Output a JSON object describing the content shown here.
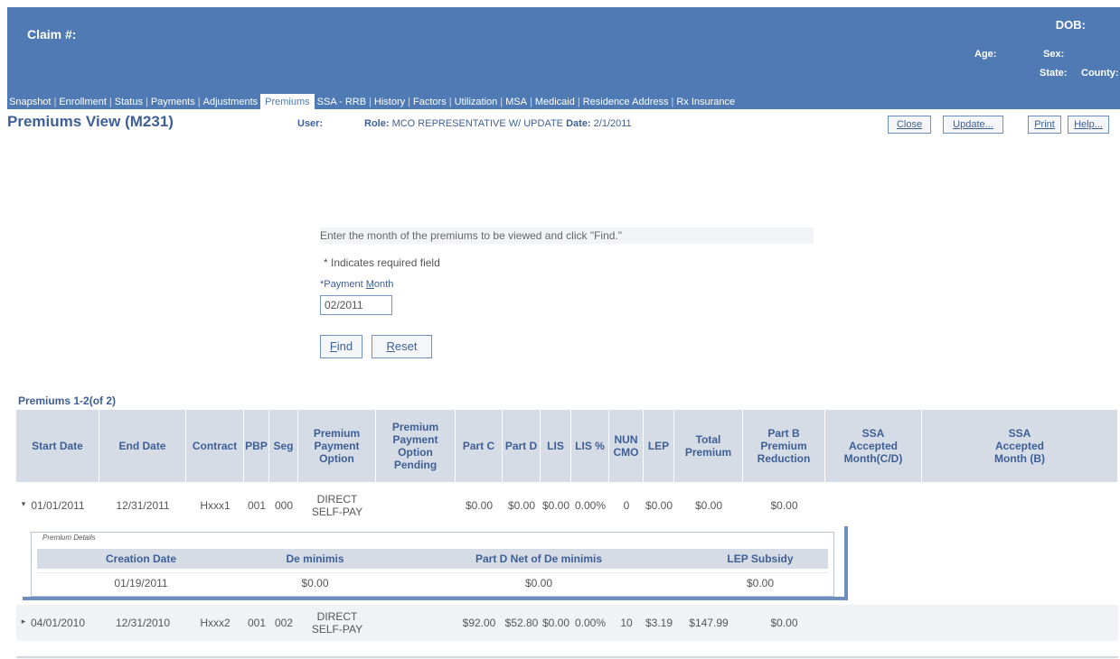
{
  "header": {
    "claim": "Claim #:",
    "dob": "DOB:",
    "age": "Age:",
    "sex": "Sex:",
    "state": "State:",
    "county": "County:"
  },
  "nav": {
    "tabs": [
      "Snapshot",
      "Enrollment",
      "Status",
      "Payments",
      "Adjustments",
      "Premiums",
      "SSA - RRB",
      "History",
      "Factors",
      "Utilization",
      "MSA",
      "Medicaid",
      "Residence Address",
      "Rx Insurance"
    ],
    "active": "Premiums"
  },
  "titlebar": {
    "title": "Premiums View (M231)",
    "user_label": "User:",
    "role_label": "Role:",
    "role_value": "MCO REPRESENTATIVE W/ UPDATE",
    "date_label": "Date:",
    "date_value": "2/1/2011",
    "buttons": {
      "close": "Close",
      "update": "Update...",
      "print": "Print",
      "help": "Help..."
    }
  },
  "form": {
    "instructions": "Enter the month of the premiums to be viewed and click \"Find.\"",
    "required_note": "* Indicates required field",
    "field_label_prefix": "*Payment ",
    "field_label_underlined": "M",
    "field_label_rest": "onth",
    "field_value": "02/2011",
    "find_u": "F",
    "find_rest": "ind",
    "reset_u": "R",
    "reset_rest": "eset"
  },
  "table": {
    "caption": "Premiums 1-2(of 2)",
    "headers": [
      "Start Date",
      "End Date",
      "Contract",
      "PBP",
      "Seg",
      "Premium\nPayment\nOption",
      "Premium\nPayment\nOption\nPending",
      "Part C",
      "Part D",
      "LIS",
      "LIS %",
      "NUN\nCMO",
      "LEP",
      "Total\nPremium",
      "Part B\nPremium\nReduction",
      "SSA\nAccepted\nMonth(C/D)",
      "SSA\nAccepted\nMonth (B)"
    ],
    "rows": [
      {
        "icon": "▾",
        "start": "01/01/2011",
        "end": "12/31/2011",
        "contract": "Hxxx1",
        "pbp": "001",
        "seg": "000",
        "option": "DIRECT\nSELF-PAY",
        "pending": "",
        "partc": "$0.00",
        "partd": "$0.00",
        "lis": "$0.00",
        "lispct": "0.00%",
        "nun": "0",
        "lep": "$0.00",
        "total": "$0.00",
        "partb": "$0.00",
        "ssacd": "",
        "ssab": ""
      },
      {
        "icon": "▸",
        "start": "04/01/2010",
        "end": "12/31/2010",
        "contract": "Hxxx2",
        "pbp": "001",
        "seg": "002",
        "option": "DIRECT\nSELF-PAY",
        "pending": "",
        "partc": "$92.00",
        "partd": "$52.80",
        "lis": "$0.00",
        "lispct": "0.00%",
        "nun": "10",
        "lep": "$3.19",
        "total": "$147.99",
        "partb": "$0.00",
        "ssacd": "",
        "ssab": ""
      }
    ],
    "detail": {
      "title": "Premium Details",
      "headers": [
        "Creation Date",
        "De minimis",
        "Part D Net of De minimis",
        "LEP Subsidy"
      ],
      "values": [
        "01/19/2011",
        "$0.00",
        "$0.00",
        "$0.00"
      ]
    }
  }
}
